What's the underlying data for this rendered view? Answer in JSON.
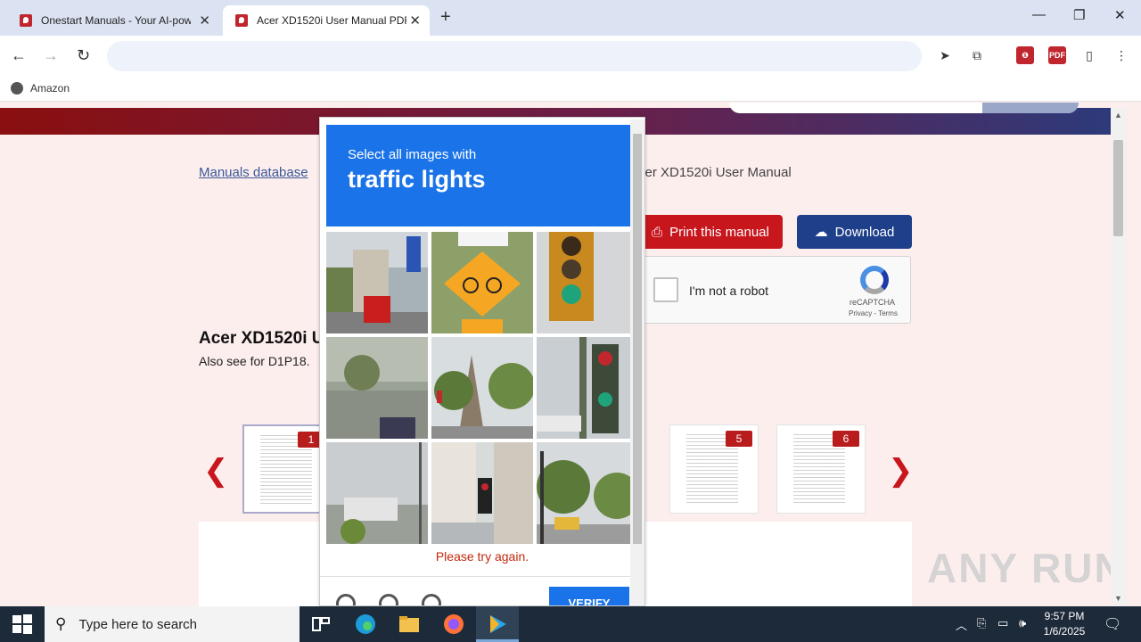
{
  "browser": {
    "tabs": [
      {
        "title": "Onestart Manuals - Your AI-pow"
      },
      {
        "title": "Acer XD1520i User Manual PDF"
      }
    ],
    "bookmarks": [
      {
        "label": "Amazon"
      }
    ]
  },
  "page": {
    "breadcrumb_link": "Manuals database",
    "breadcrumb_tail": "cer XD1520i User Manual",
    "print_button": "Print this manual",
    "download_button": "Download",
    "recaptcha": {
      "label": "I'm not a robot",
      "brand": "reCAPTCHA",
      "terms": "Privacy - Terms"
    },
    "manual_title": "Acer XD1520i U",
    "also_see": "Also see for D1P18.",
    "thumbnails": [
      {
        "num": "1"
      },
      {
        "num": "5"
      },
      {
        "num": "6"
      }
    ],
    "watermark": "ANY RUN"
  },
  "captcha": {
    "instruction": "Select all images with",
    "target": "traffic lights",
    "error": "Please try again.",
    "verify_button": "VERIFY"
  },
  "taskbar": {
    "search_placeholder": "Type here to search",
    "time": "9:57 PM",
    "date": "1/6/2025"
  }
}
